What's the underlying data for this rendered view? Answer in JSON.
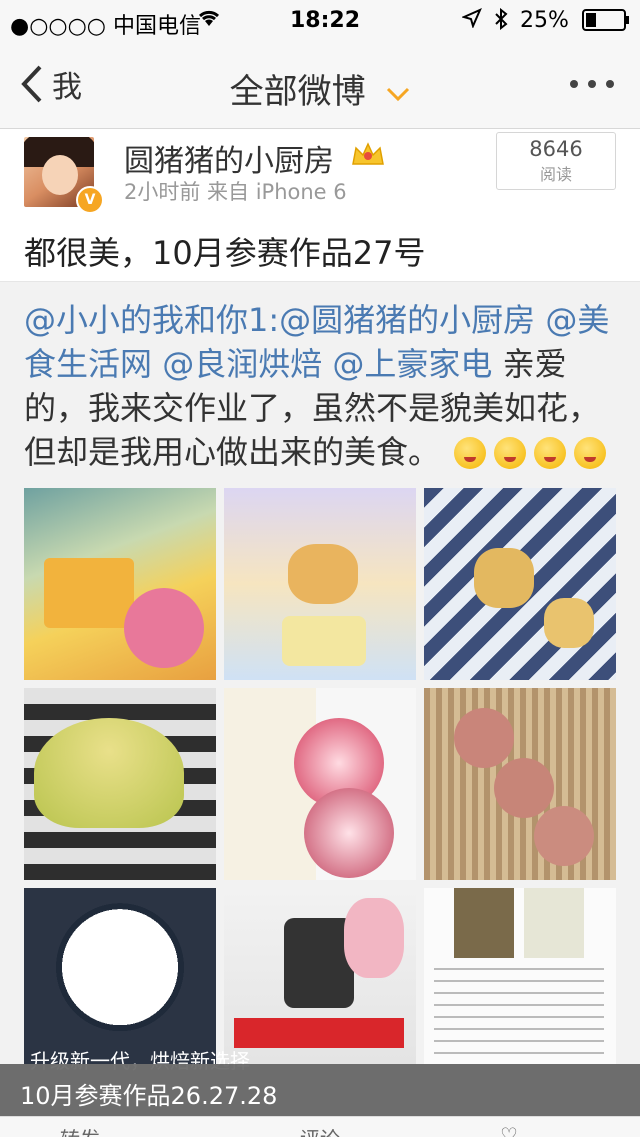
{
  "status": {
    "carrier": "●○○○○ 中国电信",
    "time": "18:22",
    "battery": "25%"
  },
  "nav": {
    "back_label": "我",
    "title": "全部微博"
  },
  "post": {
    "user": "圆猪猪的小厨房",
    "meta": "2小时前  来自 iPhone 6",
    "reads_count": "8646",
    "reads_label": "阅读",
    "text": "都很美，10月参赛作品27号"
  },
  "repost": {
    "m1": "@小小的我和你1",
    "sep": ":",
    "m2": "@圆猪猪的小厨房",
    "m3": "@美食生活网",
    "m4": "@良润烘焙",
    "m5": "@上豪家电",
    "body": " 亲爱的，我来交作业了，虽然不是貌美如花，但却是我用心做出来的美食。"
  },
  "images": {
    "overlay_text": "升级新一代，烘焙新选择",
    "caption": "10月参赛作品26.27.28"
  },
  "toolbar": {
    "repost": "转发",
    "comment": "评论"
  },
  "colors": {
    "mention": "#4a7ab2",
    "accent": "#f6a623"
  }
}
